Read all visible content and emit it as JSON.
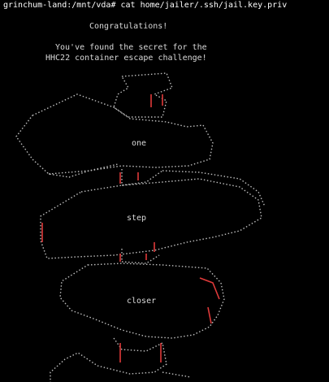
{
  "terminal": {
    "prompt": "grinchum-land:/mnt/vda#",
    "command": "cat home/jailer/.ssh/jail.key.priv",
    "congrats": "Congratulations!",
    "secret_line_1": "You've found the secret for the",
    "secret_line_2": "HHC22 container escape challenge!"
  },
  "art": {
    "words": [
      "one",
      "step",
      "closer"
    ],
    "text_color": "#d9d9d9",
    "accent_color": "#e03a3a"
  }
}
